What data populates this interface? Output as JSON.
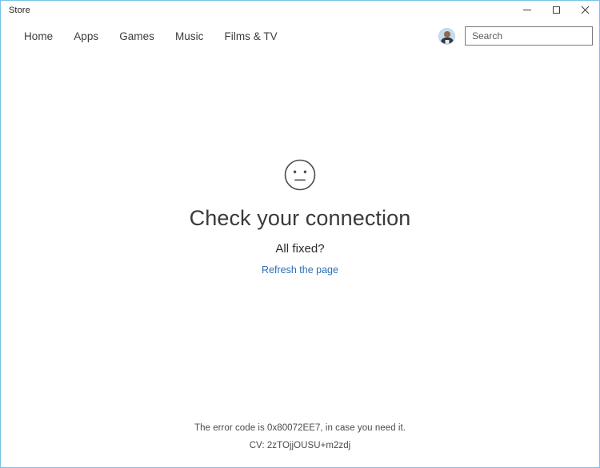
{
  "window": {
    "title": "Store",
    "border_color": "#7ac2e8",
    "caption_buttons": {
      "minimize_label": "Minimize",
      "maximize_label": "Maximize",
      "close_label": "Close"
    }
  },
  "nav": {
    "items": [
      {
        "label": "Home"
      },
      {
        "label": "Apps"
      },
      {
        "label": "Games"
      },
      {
        "label": "Music"
      },
      {
        "label": "Films & TV"
      }
    ]
  },
  "account": {
    "avatar_label": "User account picture"
  },
  "search": {
    "value": "",
    "placeholder": "Search",
    "icon": "search-icon"
  },
  "main": {
    "status_icon": "neutral-face-icon",
    "headline": "Check your connection",
    "subhead": "All fixed?",
    "refresh_link": "Refresh the page",
    "link_color": "#2b6fb5"
  },
  "footer": {
    "error_code_text": "The error code is 0x80072EE7, in case you need it.",
    "error_code": "0x80072EE7",
    "cv_text": "CV: 2zTOjjOUSU+m2zdj",
    "cv_value": "2zTOjjOUSU+m2zdj"
  }
}
